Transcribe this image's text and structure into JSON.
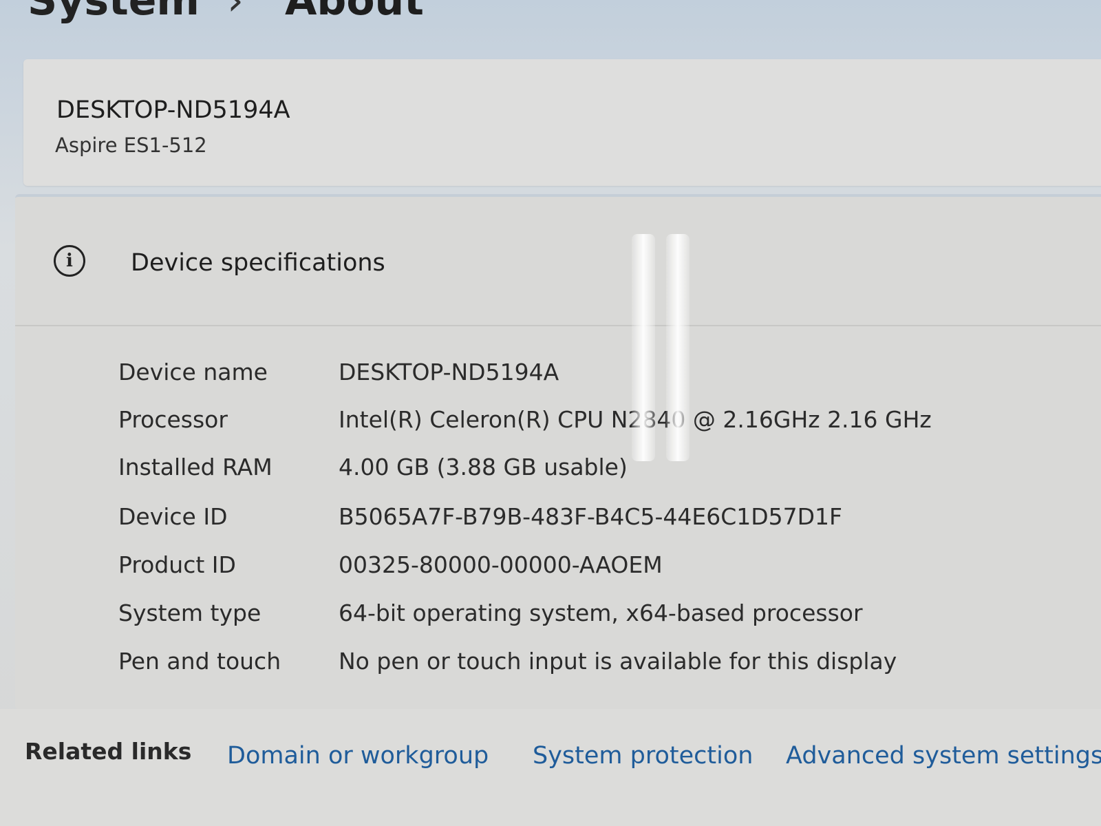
{
  "breadcrumb": {
    "parent": "System",
    "separator": "›",
    "current": "About"
  },
  "device": {
    "name": "DESKTOP-ND5194A",
    "model": "Aspire ES1-512"
  },
  "specs": {
    "title": "Device specifications",
    "icon": "info-icon",
    "rows": [
      {
        "label": "Device name",
        "value": "DESKTOP-ND5194A"
      },
      {
        "label": "Processor",
        "value": "Intel(R) Celeron(R) CPU  N2840  @ 2.16GHz   2.16 GHz"
      },
      {
        "label": "Installed RAM",
        "value": "4.00 GB (3.88 GB usable)"
      },
      {
        "label": "Device ID",
        "value": "B5065A7F-B79B-483F-B4C5-44E6C1D57D1F"
      },
      {
        "label": "Product ID",
        "value": "00325-80000-00000-AAOEM"
      },
      {
        "label": "System type",
        "value": "64-bit operating system, x64-based processor"
      },
      {
        "label": "Pen and touch",
        "value": "No pen or touch input is available for this display"
      }
    ]
  },
  "related": {
    "label": "Related links",
    "links": [
      "Domain or workgroup",
      "System protection",
      "Advanced system settings"
    ]
  }
}
